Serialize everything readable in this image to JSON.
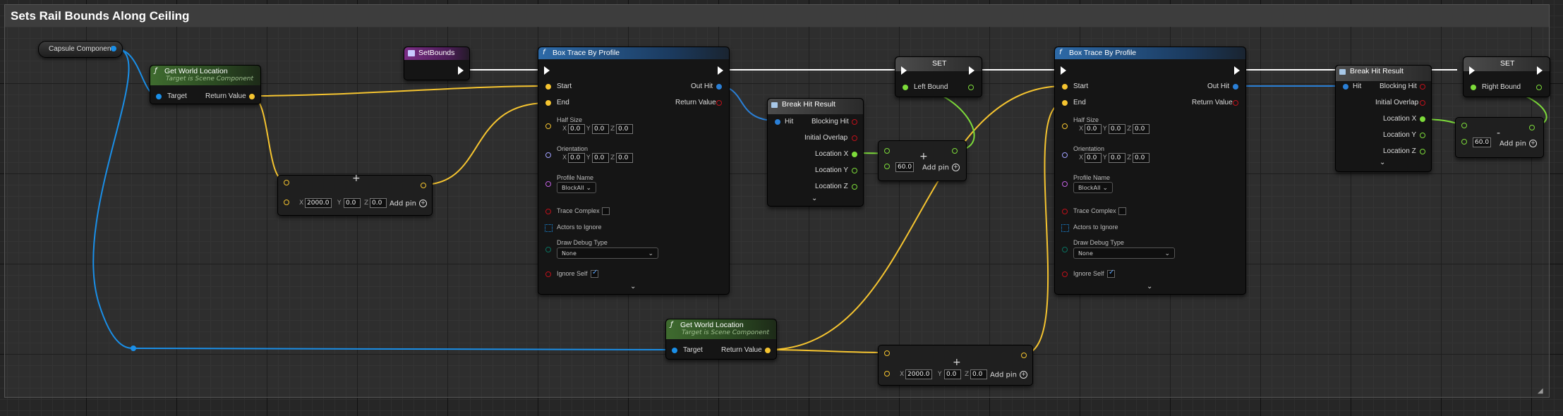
{
  "comment": {
    "title": "Sets Rail Bounds Along Ceiling"
  },
  "colors": {
    "exec": "#ffffff",
    "vector": "#f5c430",
    "object": "#1a8fe8",
    "float": "#7ddb3a",
    "struct": "#2a7fd6",
    "bool": "#c0101a",
    "name": "#c060e0",
    "enum": "#0a7060",
    "rotator": "#a0a0ff",
    "array": "#1a8fe8"
  },
  "nodes": {
    "capsule": {
      "label": "Capsule Component"
    },
    "gwl1": {
      "title": "Get World Location",
      "subtitle": "Target is Scene Component",
      "target": "Target",
      "ret": "Return Value"
    },
    "gwl2": {
      "title": "Get World Location",
      "subtitle": "Target is Scene Component",
      "target": "Target",
      "ret": "Return Value"
    },
    "setbounds": {
      "title": "SetBounds"
    },
    "add1": {
      "op": "+",
      "x_label": "X",
      "y_label": "Y",
      "z_label": "Z",
      "x": "2000.0",
      "y": "0.0",
      "z": "0.0",
      "addpin": "Add pin"
    },
    "add2": {
      "op": "+",
      "x_label": "X",
      "y_label": "Y",
      "z_label": "Z",
      "x": "2000.0",
      "y": "0.0",
      "z": "0.0",
      "addpin": "Add pin"
    },
    "bt1": {
      "title": "Box Trace By Profile",
      "icon": "f",
      "start": "Start",
      "end": "End",
      "out_hit": "Out Hit",
      "ret": "Return Value",
      "half_size": "Half Size",
      "hs": {
        "x": "0.0",
        "y": "0.0",
        "z": "0.0"
      },
      "orientation": "Orientation",
      "or": {
        "x": "0.0",
        "y": "0.0",
        "z": "0.0"
      },
      "profile_name": "Profile Name",
      "profile_value": "BlockAll",
      "trace_complex": "Trace Complex",
      "actors_ignore": "Actors to Ignore",
      "draw_debug": "Draw Debug Type",
      "draw_debug_value": "None",
      "ignore_self": "Ignore Self",
      "x_label": "X",
      "y_label": "Y",
      "z_label": "Z"
    },
    "bt2": {
      "title": "Box Trace By Profile",
      "icon": "f",
      "start": "Start",
      "end": "End",
      "out_hit": "Out Hit",
      "ret": "Return Value",
      "half_size": "Half Size",
      "hs": {
        "x": "0.0",
        "y": "0.0",
        "z": "0.0"
      },
      "orientation": "Orientation",
      "or": {
        "x": "0.0",
        "y": "0.0",
        "z": "0.0"
      },
      "profile_name": "Profile Name",
      "profile_value": "BlockAll",
      "trace_complex": "Trace Complex",
      "actors_ignore": "Actors to Ignore",
      "draw_debug": "Draw Debug Type",
      "draw_debug_value": "None",
      "ignore_self": "Ignore Self",
      "x_label": "X",
      "y_label": "Y",
      "z_label": "Z"
    },
    "bhr1": {
      "title": "Break Hit Result",
      "hit": "Hit",
      "blocking": "Blocking Hit",
      "overlap": "Initial Overlap",
      "lx": "Location X",
      "ly": "Location Y",
      "lz": "Location Z"
    },
    "bhr2": {
      "title": "Break Hit Result",
      "hit": "Hit",
      "blocking": "Blocking Hit",
      "overlap": "Initial Overlap",
      "lx": "Location X",
      "ly": "Location Y",
      "lz": "Location Z"
    },
    "set1": {
      "title": "SET",
      "var": "Left Bound"
    },
    "set2": {
      "title": "SET",
      "var": "Right Bound"
    },
    "fadd": {
      "op": "+",
      "value": "60.0",
      "addpin": "Add pin"
    },
    "fsub": {
      "op": "-",
      "value": "60.0",
      "addpin": "Add pin"
    }
  }
}
